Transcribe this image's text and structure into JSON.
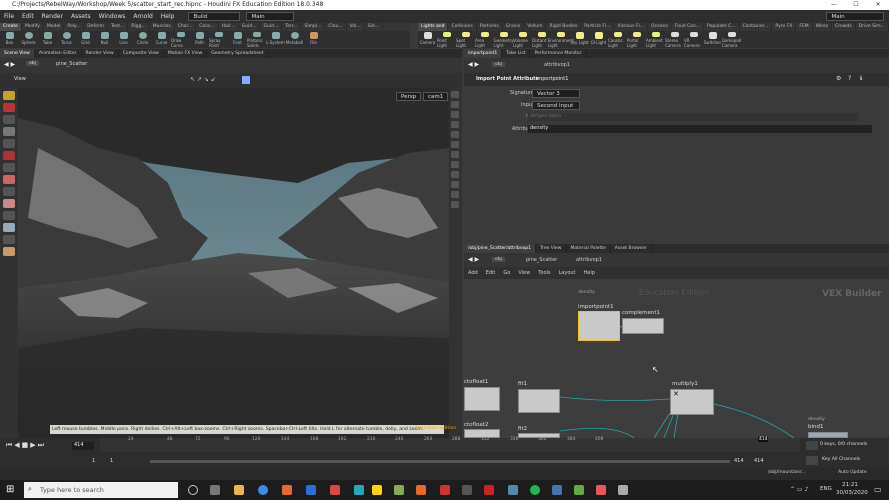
{
  "window": {
    "title": "C:/Projects/RebelWay/Workshop/Week 5/scatter_start_rec.hipnc - Houdini FX Education Edition 18.0.348"
  },
  "menu": {
    "items": [
      "File",
      "Edit",
      "Render",
      "Assets",
      "Windows",
      "Arnold",
      "Help"
    ],
    "desktop_left": "Build",
    "desktop_mid": "Main",
    "desktop_right": "Main"
  },
  "shelf": {
    "tabs": [
      "Create",
      "Modify",
      "Model",
      "Poly...",
      "Deform",
      "Text...",
      "Rigg...",
      "Muscles",
      "Char...",
      "Cons...",
      "Hair...",
      "Guid...",
      "Guid...",
      "Terr...",
      "Simpl...",
      "Clou...",
      "Vol...",
      "Sid..."
    ],
    "tools": [
      "Box",
      "Sphere",
      "Tube",
      "Torus",
      "Grid",
      "Null",
      "Line",
      "Circle",
      "Curve",
      "Draw Curve",
      "Path",
      "Spray Paint",
      "Font",
      "Platonic Solids",
      "L-System",
      "Metaball",
      "File"
    ]
  },
  "shelf2": {
    "tabs": [
      "Lights and",
      "Collisions",
      "Particles",
      "Grains",
      "Vellum",
      "Rigid Bodies",
      "Particle Fl...",
      "Viscous Fl...",
      "Oceans",
      "Fluid Con...",
      "Populate C...",
      "Container...",
      "Pyro FX",
      "FEM",
      "Wires",
      "Crowds",
      "Drive Sim..."
    ],
    "tools": [
      "Camera",
      "Point Light",
      "Spot Light",
      "Area Light",
      "Geometry Light",
      "Volume Light",
      "Distant Light",
      "Environment Light",
      "Sky Light",
      "GI Light",
      "Caustic Light",
      "Portal Light",
      "Ambient Light",
      "Stereo Camera",
      "VR Camera",
      "Switcher",
      "Gamepad Camera"
    ]
  },
  "left_pane": {
    "tabs": [
      "Scene View",
      "Animation Editor",
      "Render View",
      "Composite View",
      "Motion FX View",
      "Geometry Spreadsheet"
    ],
    "view_label": "View",
    "context": "obj",
    "node": "pine_Scatter",
    "persp": "Persp",
    "cam": "cam1",
    "help": "Left mouse tumbles. Middle pans. Right dollies. Ctrl+Alt+Left box-zooms. Ctrl+Right zooms. Spacebar-Ctrl-Left tilts. Hold L for alternate tumble, dolly, and zoom.",
    "edition": "Education Edition"
  },
  "parm_pane": {
    "tabs": [
      "importpoint1",
      "Take List",
      "Performance Monitor"
    ],
    "context": "obj",
    "node": "attribvop1",
    "node_type": "Import Point Attribute",
    "node_name": "importpoint1",
    "rows": [
      {
        "label": "Signature",
        "value": "Vector 3"
      },
      {
        "label": "Input",
        "value": "Second Input"
      },
      {
        "label": "File",
        "value": "defgeo.bgeo"
      },
      {
        "label": "Attribute",
        "value": "density"
      }
    ]
  },
  "net_pane": {
    "tabs": [
      "/obj/pine_Scatter/attribvop1",
      "Tree View",
      "Material Palette",
      "Asset Browser"
    ],
    "context": "obj",
    "node": "pine_Scatter",
    "subnode": "attribvop1",
    "menu": [
      "Add",
      "Edit",
      "Go",
      "View",
      "Tools",
      "Layout",
      "Help"
    ],
    "watermark": "Education Edition",
    "builder": "VEX Builder",
    "nodes": [
      {
        "name": "importpoint1",
        "label": "density"
      },
      {
        "name": "complement1",
        "label": ""
      },
      {
        "name": "ctofloat1",
        "label": ""
      },
      {
        "name": "fit1",
        "label": ""
      },
      {
        "name": "multiply1",
        "label": ""
      },
      {
        "name": "ctofloat2",
        "label": ""
      },
      {
        "name": "fit2",
        "label": ""
      },
      {
        "name": "bind1",
        "label": "density"
      }
    ]
  },
  "timeline": {
    "frame": "414",
    "ticks": [
      "24",
      "48",
      "72",
      "96",
      "120",
      "144",
      "168",
      "192",
      "216",
      "240",
      "264",
      "288",
      "312",
      "336",
      "360",
      "384",
      "408"
    ],
    "start": "1",
    "start2": "1",
    "end": "414",
    "end2": "414",
    "current_marker": "414",
    "keys": "0 keys, 0/0 channels",
    "key_all": "Key All Channels",
    "path": "/obj/mountain/...",
    "auto_update": "Auto Update"
  },
  "taskbar": {
    "search": "Type here to search",
    "lang": "ENG",
    "time": "21:21",
    "date": "30/03/2020"
  }
}
